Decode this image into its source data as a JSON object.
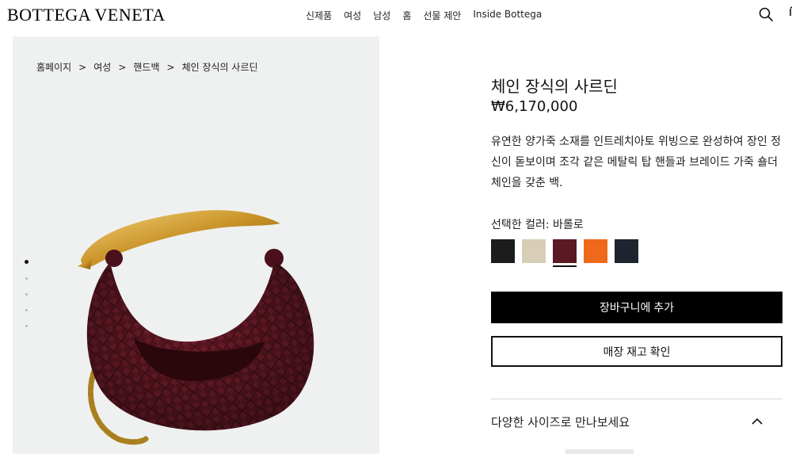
{
  "header": {
    "logo": "BOTTEGA VENETA",
    "nav": [
      "신제품",
      "여성",
      "남성",
      "홈",
      "선물 제안",
      "Inside Bottega"
    ],
    "search_icon": "search-icon"
  },
  "breadcrumb": [
    "홈페이지",
    "여성",
    "핸드백",
    "체인 장식의 사르딘"
  ],
  "breadcrumb_separator": ">",
  "gallery": {
    "image_count": 5,
    "active_index": 0,
    "image": "burgundy-woven-leather-hobo-bag-with-gold-handle"
  },
  "product": {
    "title": "체인 장식의 사르딘",
    "price": "₩6,170,000",
    "description": "유연한 양가죽 소재를 인트레치아토 위빙으로 완성하여 장인 정신이 돋보이며 조각 같은 메탈릭 탑 핸들과 브레이드 가죽 숄더 체인을 갖춘 백.",
    "color_label": "선택한 컬러: 바롤로",
    "colors": [
      {
        "name": "black",
        "hex": "#1c1c1c"
      },
      {
        "name": "beige",
        "hex": "#d8cdb7"
      },
      {
        "name": "barolo",
        "hex": "#5a1a24",
        "selected": true
      },
      {
        "name": "orange",
        "hex": "#ee6a1a"
      },
      {
        "name": "navy",
        "hex": "#1e2530"
      }
    ],
    "add_to_cart": "장바구니에 추가",
    "check_store": "매장 재고 확인",
    "sizes_label": "다양한 사이즈로 만나보세요"
  }
}
